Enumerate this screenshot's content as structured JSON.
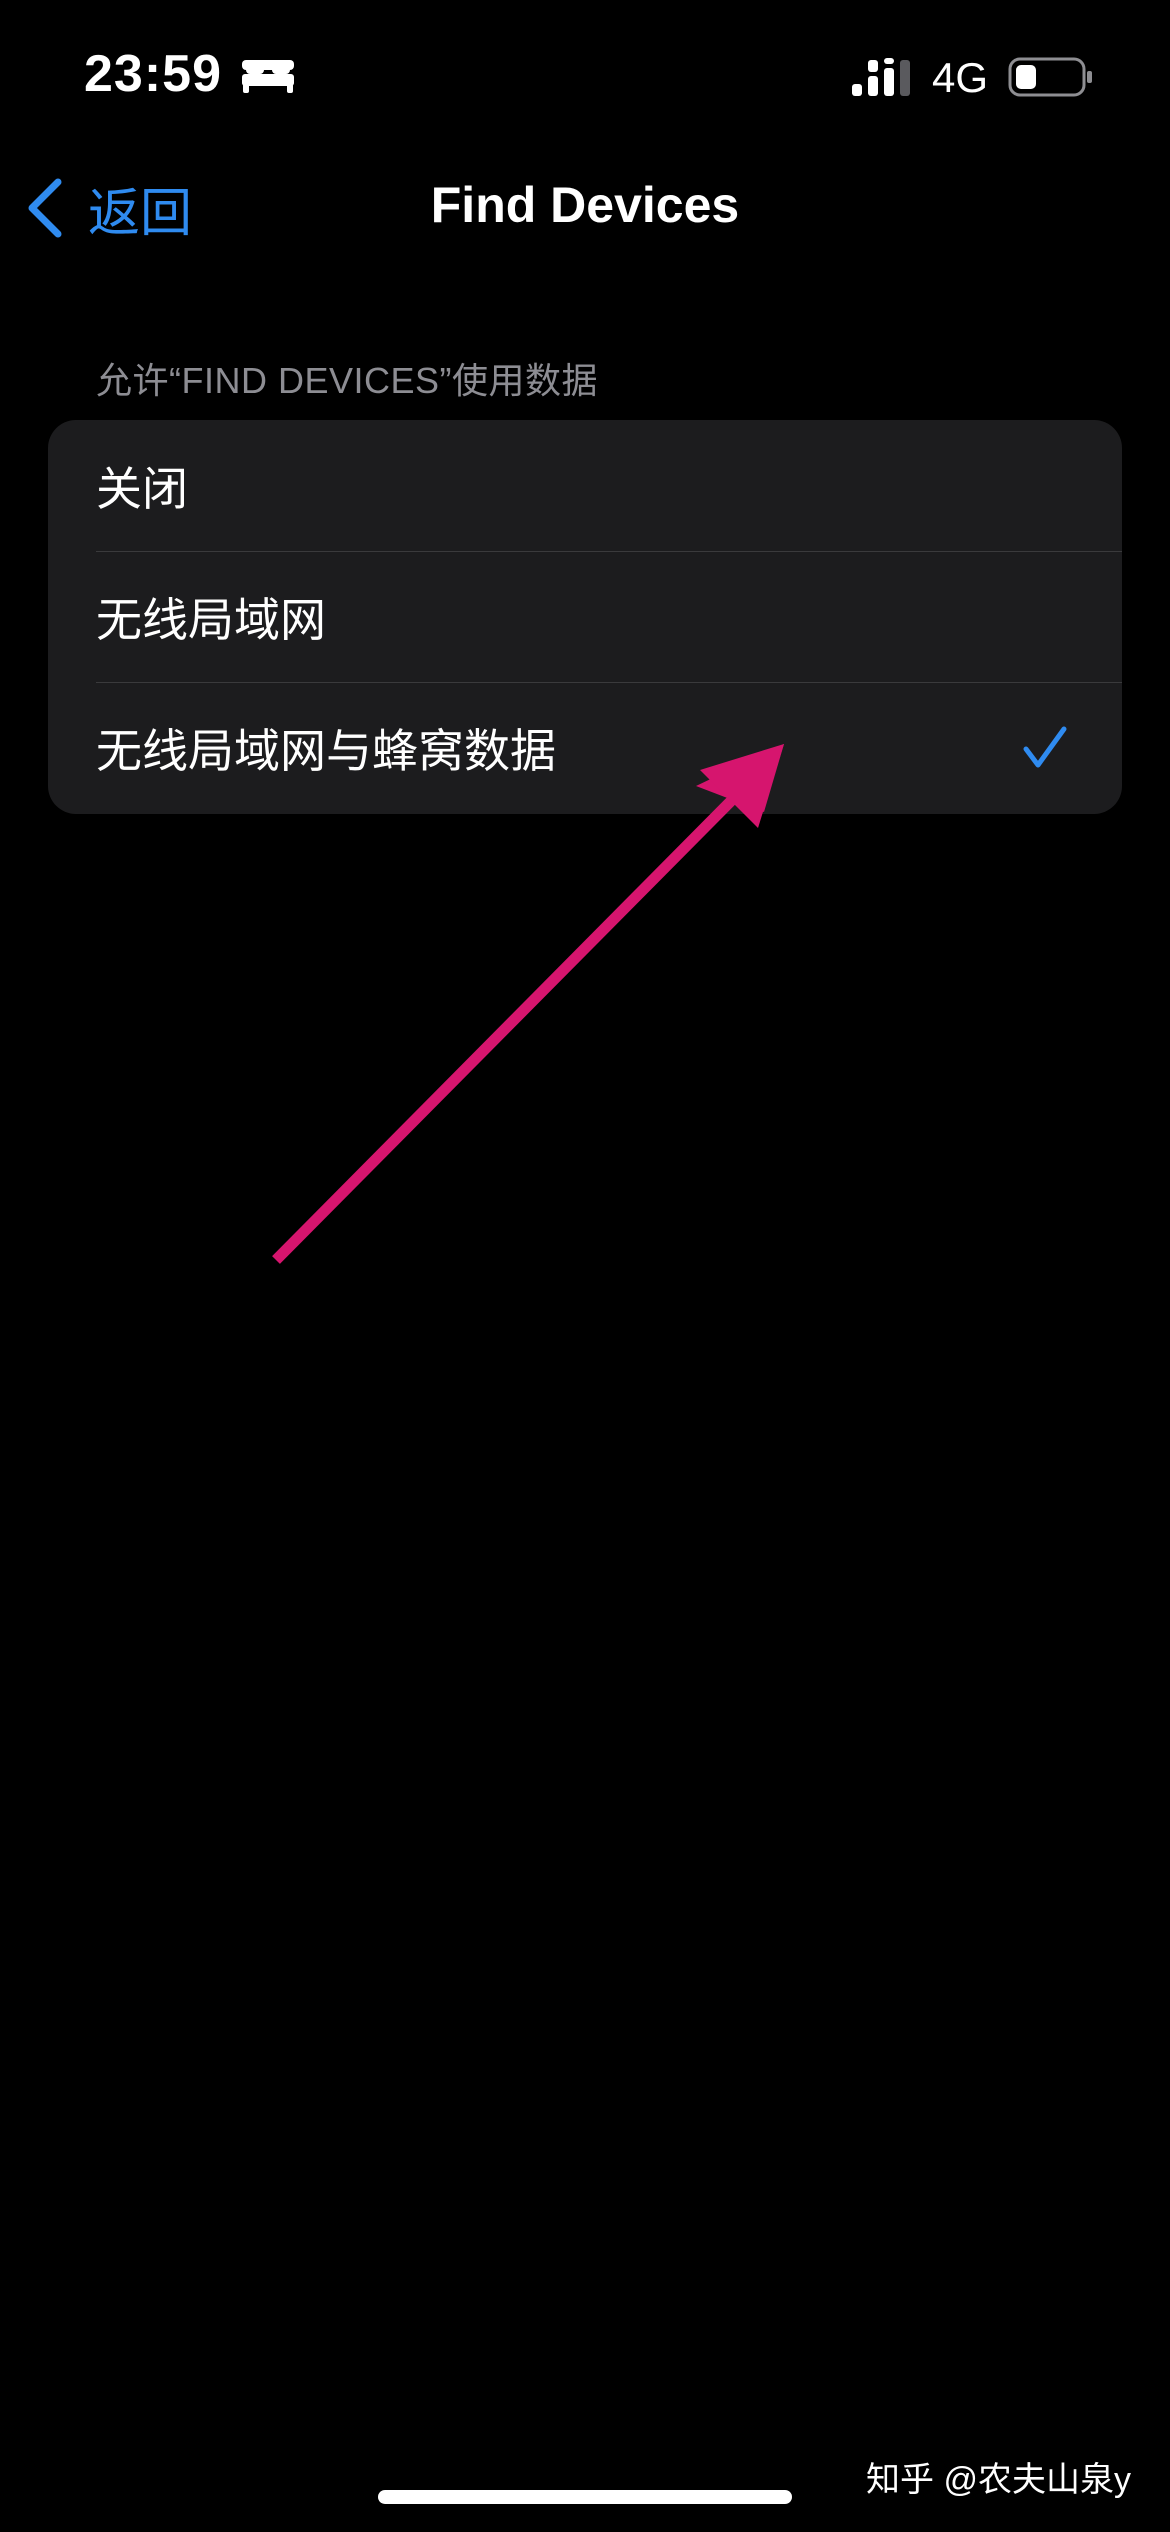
{
  "status_bar": {
    "time": "23:59",
    "network": "4G",
    "icons": [
      "sleep-bed-icon",
      "cellular-signal-icon",
      "battery-icon"
    ]
  },
  "nav": {
    "back_label": "返回",
    "title": "Find Devices"
  },
  "section": {
    "header": "允许“FIND DEVICES”使用数据",
    "options": [
      {
        "label": "关闭",
        "selected": false
      },
      {
        "label": "无线局域网",
        "selected": false
      },
      {
        "label": "无线局域网与蜂窝数据",
        "selected": true
      }
    ]
  },
  "watermark": "知乎 @农夫山泉y",
  "colors": {
    "background": "#000000",
    "group_background": "#1c1c1e",
    "accent": "#2f8bf0",
    "secondary_text": "#8d8d93",
    "annotation_arrow": "#d6156e"
  }
}
